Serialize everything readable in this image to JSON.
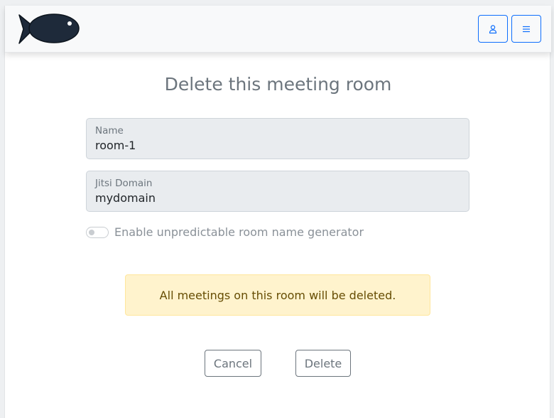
{
  "header": {
    "logo_icon": "fish-logo",
    "user_button_icon": "person-icon",
    "menu_button_icon": "hamburger-menu-icon",
    "accent_color": "#0d6efd"
  },
  "page_title": "Delete this meeting room",
  "form": {
    "name": {
      "label": "Name",
      "value": "room-1"
    },
    "jitsi_domain": {
      "label": "Jitsi Domain",
      "value": "mydomain"
    },
    "toggle": {
      "label": "Enable unpredictable room name generator",
      "checked": false
    }
  },
  "alert": {
    "text": "All meetings on this room will be deleted.",
    "color": "#fff3cd"
  },
  "actions": {
    "cancel_label": "Cancel",
    "delete_label": "Delete"
  }
}
